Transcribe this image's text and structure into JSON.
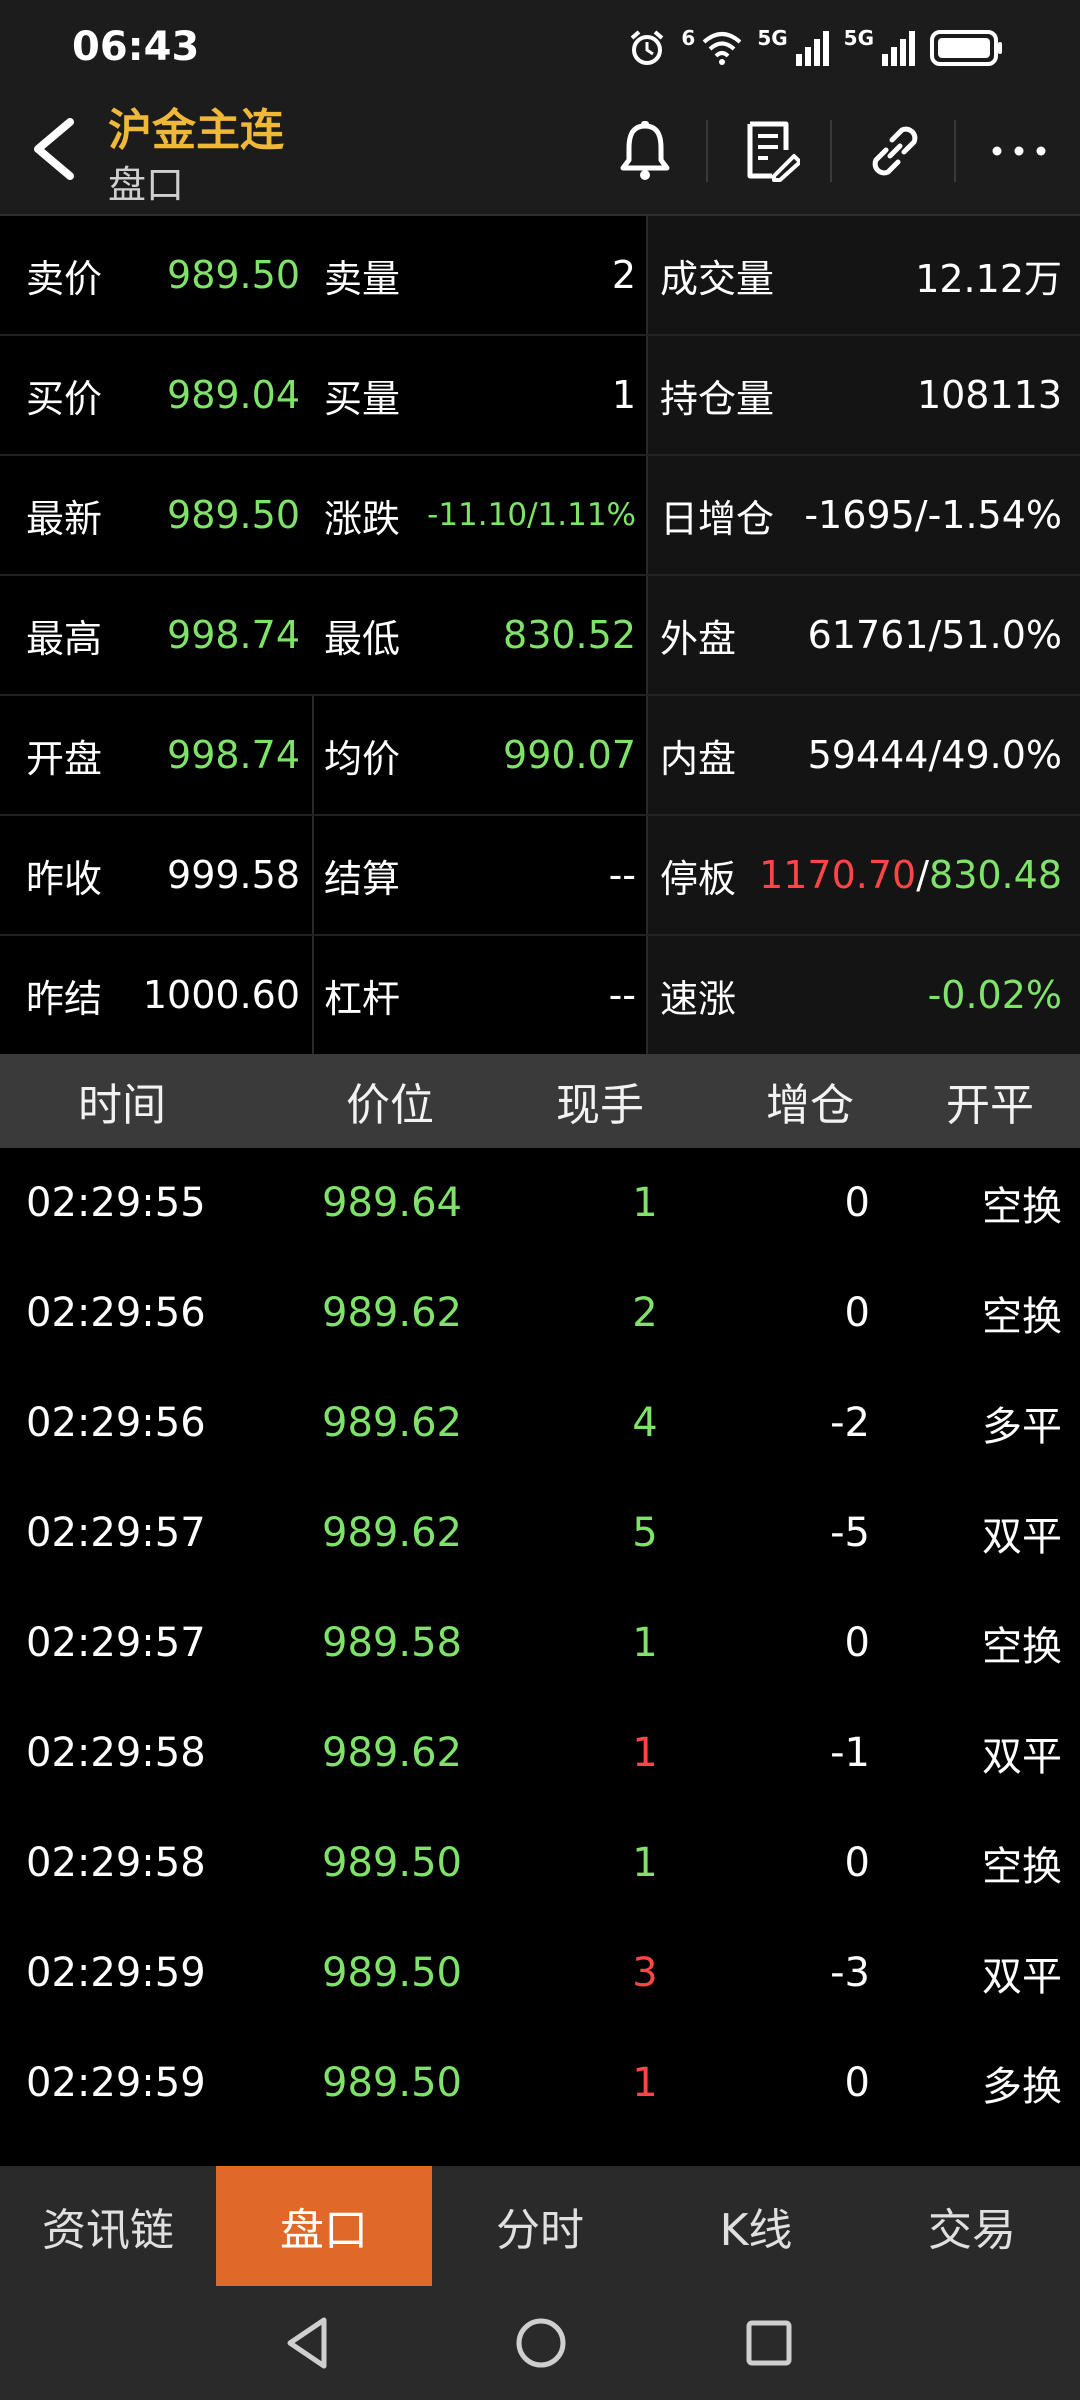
{
  "status": {
    "time": "06:43",
    "net1": "6",
    "net2": "5G",
    "net3": "5G"
  },
  "header": {
    "title": "沪金主连",
    "subtitle": "盘口"
  },
  "quote": {
    "rows": [
      {
        "l1": "卖价",
        "v1": "989.50",
        "l2": "卖量",
        "v2": "2",
        "l3": "成交量",
        "v3": "12.12万"
      },
      {
        "l1": "买价",
        "v1": "989.04",
        "l2": "买量",
        "v2": "1",
        "l3": "持仓量",
        "v3": "108113"
      },
      {
        "l1": "最新",
        "v1": "989.50",
        "l2": "涨跌",
        "v2": "-11.10/1.11%",
        "l3": "日增仓",
        "v3": "-1695/-1.54%"
      },
      {
        "l1": "最高",
        "v1": "998.74",
        "l2": "最低",
        "v2": "830.52",
        "l3": "外盘",
        "v3": "61761/51.0%"
      },
      {
        "l1": "开盘",
        "v1": "998.74",
        "l2": "均价",
        "v2": "990.07",
        "l3": "内盘",
        "v3": "59444/49.0%"
      },
      {
        "l1": "昨收",
        "v1": "999.58",
        "l2": "结算",
        "v2": "--",
        "l3": "停板",
        "v3a": "1170.70",
        "v3sep": "/",
        "v3b": "830.48"
      },
      {
        "l1": "昨结",
        "v1": "1000.60",
        "l2": "杠杆",
        "v2": "--",
        "l3": "速涨",
        "v3": "-0.02%"
      }
    ]
  },
  "table": {
    "headers": [
      "时间",
      "价位",
      "现手",
      "增仓",
      "开平"
    ],
    "rows": [
      {
        "time": "02:29:55",
        "price": "989.64",
        "vol": "1",
        "oi": "0",
        "type": "空换"
      },
      {
        "time": "02:29:56",
        "price": "989.62",
        "vol": "2",
        "oi": "0",
        "type": "空换"
      },
      {
        "time": "02:29:56",
        "price": "989.62",
        "vol": "4",
        "oi": "-2",
        "type": "多平"
      },
      {
        "time": "02:29:57",
        "price": "989.62",
        "vol": "5",
        "oi": "-5",
        "type": "双平"
      },
      {
        "time": "02:29:57",
        "price": "989.58",
        "vol": "1",
        "oi": "0",
        "type": "空换"
      },
      {
        "time": "02:29:58",
        "price": "989.62",
        "vol": "1",
        "oi": "-1",
        "type": "双平"
      },
      {
        "time": "02:29:58",
        "price": "989.50",
        "vol": "1",
        "oi": "0",
        "type": "空换"
      },
      {
        "time": "02:29:59",
        "price": "989.50",
        "vol": "3",
        "oi": "-3",
        "type": "双平"
      },
      {
        "time": "02:29:59",
        "price": "989.50",
        "vol": "1",
        "oi": "0",
        "type": "多换"
      }
    ]
  },
  "tabs": [
    "资讯链",
    "盘口",
    "分时",
    "K线",
    "交易"
  ],
  "colors": {
    "up": "#ff4545",
    "down": "#7fe36a",
    "accent": "#e0692a",
    "title": "#f0b838"
  },
  "icons": {
    "header": [
      "bell-icon",
      "note-icon",
      "link-icon",
      "more-icon"
    ],
    "nav": [
      "back-triangle-icon",
      "home-circle-icon",
      "recents-square-icon"
    ]
  }
}
